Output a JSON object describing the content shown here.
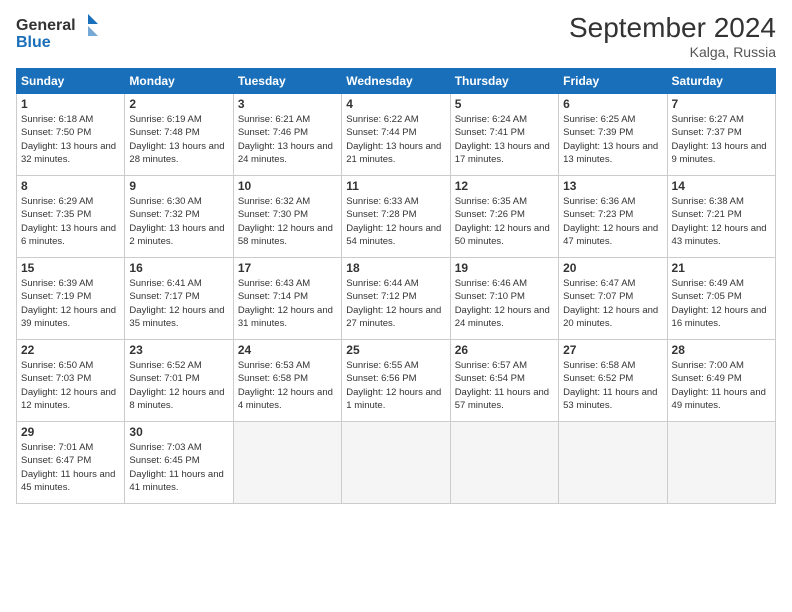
{
  "header": {
    "logo_text_general": "General",
    "logo_text_blue": "Blue",
    "month_title": "September 2024",
    "location": "Kalga, Russia"
  },
  "days_of_week": [
    "Sunday",
    "Monday",
    "Tuesday",
    "Wednesday",
    "Thursday",
    "Friday",
    "Saturday"
  ],
  "weeks": [
    [
      {
        "day": "1",
        "sunrise": "6:18 AM",
        "sunset": "7:50 PM",
        "daylight": "13 hours and 32 minutes."
      },
      {
        "day": "2",
        "sunrise": "6:19 AM",
        "sunset": "7:48 PM",
        "daylight": "13 hours and 28 minutes."
      },
      {
        "day": "3",
        "sunrise": "6:21 AM",
        "sunset": "7:46 PM",
        "daylight": "13 hours and 24 minutes."
      },
      {
        "day": "4",
        "sunrise": "6:22 AM",
        "sunset": "7:44 PM",
        "daylight": "13 hours and 21 minutes."
      },
      {
        "day": "5",
        "sunrise": "6:24 AM",
        "sunset": "7:41 PM",
        "daylight": "13 hours and 17 minutes."
      },
      {
        "day": "6",
        "sunrise": "6:25 AM",
        "sunset": "7:39 PM",
        "daylight": "13 hours and 13 minutes."
      },
      {
        "day": "7",
        "sunrise": "6:27 AM",
        "sunset": "7:37 PM",
        "daylight": "13 hours and 9 minutes."
      }
    ],
    [
      {
        "day": "8",
        "sunrise": "6:29 AM",
        "sunset": "7:35 PM",
        "daylight": "13 hours and 6 minutes."
      },
      {
        "day": "9",
        "sunrise": "6:30 AM",
        "sunset": "7:32 PM",
        "daylight": "13 hours and 2 minutes."
      },
      {
        "day": "10",
        "sunrise": "6:32 AM",
        "sunset": "7:30 PM",
        "daylight": "12 hours and 58 minutes."
      },
      {
        "day": "11",
        "sunrise": "6:33 AM",
        "sunset": "7:28 PM",
        "daylight": "12 hours and 54 minutes."
      },
      {
        "day": "12",
        "sunrise": "6:35 AM",
        "sunset": "7:26 PM",
        "daylight": "12 hours and 50 minutes."
      },
      {
        "day": "13",
        "sunrise": "6:36 AM",
        "sunset": "7:23 PM",
        "daylight": "12 hours and 47 minutes."
      },
      {
        "day": "14",
        "sunrise": "6:38 AM",
        "sunset": "7:21 PM",
        "daylight": "12 hours and 43 minutes."
      }
    ],
    [
      {
        "day": "15",
        "sunrise": "6:39 AM",
        "sunset": "7:19 PM",
        "daylight": "12 hours and 39 minutes."
      },
      {
        "day": "16",
        "sunrise": "6:41 AM",
        "sunset": "7:17 PM",
        "daylight": "12 hours and 35 minutes."
      },
      {
        "day": "17",
        "sunrise": "6:43 AM",
        "sunset": "7:14 PM",
        "daylight": "12 hours and 31 minutes."
      },
      {
        "day": "18",
        "sunrise": "6:44 AM",
        "sunset": "7:12 PM",
        "daylight": "12 hours and 27 minutes."
      },
      {
        "day": "19",
        "sunrise": "6:46 AM",
        "sunset": "7:10 PM",
        "daylight": "12 hours and 24 minutes."
      },
      {
        "day": "20",
        "sunrise": "6:47 AM",
        "sunset": "7:07 PM",
        "daylight": "12 hours and 20 minutes."
      },
      {
        "day": "21",
        "sunrise": "6:49 AM",
        "sunset": "7:05 PM",
        "daylight": "12 hours and 16 minutes."
      }
    ],
    [
      {
        "day": "22",
        "sunrise": "6:50 AM",
        "sunset": "7:03 PM",
        "daylight": "12 hours and 12 minutes."
      },
      {
        "day": "23",
        "sunrise": "6:52 AM",
        "sunset": "7:01 PM",
        "daylight": "12 hours and 8 minutes."
      },
      {
        "day": "24",
        "sunrise": "6:53 AM",
        "sunset": "6:58 PM",
        "daylight": "12 hours and 4 minutes."
      },
      {
        "day": "25",
        "sunrise": "6:55 AM",
        "sunset": "6:56 PM",
        "daylight": "12 hours and 1 minute."
      },
      {
        "day": "26",
        "sunrise": "6:57 AM",
        "sunset": "6:54 PM",
        "daylight": "11 hours and 57 minutes."
      },
      {
        "day": "27",
        "sunrise": "6:58 AM",
        "sunset": "6:52 PM",
        "daylight": "11 hours and 53 minutes."
      },
      {
        "day": "28",
        "sunrise": "7:00 AM",
        "sunset": "6:49 PM",
        "daylight": "11 hours and 49 minutes."
      }
    ],
    [
      {
        "day": "29",
        "sunrise": "7:01 AM",
        "sunset": "6:47 PM",
        "daylight": "11 hours and 45 minutes."
      },
      {
        "day": "30",
        "sunrise": "7:03 AM",
        "sunset": "6:45 PM",
        "daylight": "11 hours and 41 minutes."
      },
      null,
      null,
      null,
      null,
      null
    ]
  ]
}
